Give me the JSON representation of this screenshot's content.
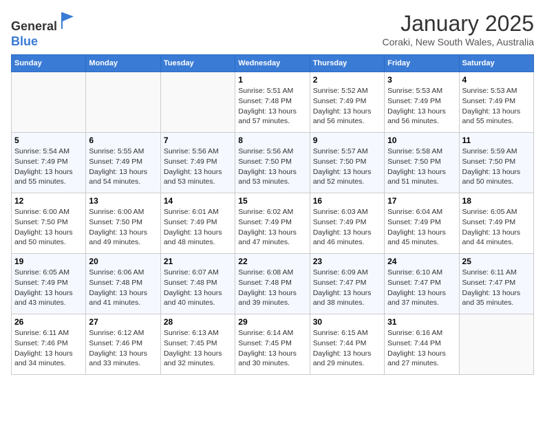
{
  "header": {
    "logo_general": "General",
    "logo_blue": "Blue",
    "month_title": "January 2025",
    "subtitle": "Coraki, New South Wales, Australia"
  },
  "days_of_week": [
    "Sunday",
    "Monday",
    "Tuesday",
    "Wednesday",
    "Thursday",
    "Friday",
    "Saturday"
  ],
  "weeks": [
    [
      {
        "day": "",
        "sunrise": "",
        "sunset": "",
        "daylight": ""
      },
      {
        "day": "",
        "sunrise": "",
        "sunset": "",
        "daylight": ""
      },
      {
        "day": "",
        "sunrise": "",
        "sunset": "",
        "daylight": ""
      },
      {
        "day": "1",
        "sunrise": "Sunrise: 5:51 AM",
        "sunset": "Sunset: 7:48 PM",
        "daylight": "Daylight: 13 hours and 57 minutes."
      },
      {
        "day": "2",
        "sunrise": "Sunrise: 5:52 AM",
        "sunset": "Sunset: 7:49 PM",
        "daylight": "Daylight: 13 hours and 56 minutes."
      },
      {
        "day": "3",
        "sunrise": "Sunrise: 5:53 AM",
        "sunset": "Sunset: 7:49 PM",
        "daylight": "Daylight: 13 hours and 56 minutes."
      },
      {
        "day": "4",
        "sunrise": "Sunrise: 5:53 AM",
        "sunset": "Sunset: 7:49 PM",
        "daylight": "Daylight: 13 hours and 55 minutes."
      }
    ],
    [
      {
        "day": "5",
        "sunrise": "Sunrise: 5:54 AM",
        "sunset": "Sunset: 7:49 PM",
        "daylight": "Daylight: 13 hours and 55 minutes."
      },
      {
        "day": "6",
        "sunrise": "Sunrise: 5:55 AM",
        "sunset": "Sunset: 7:49 PM",
        "daylight": "Daylight: 13 hours and 54 minutes."
      },
      {
        "day": "7",
        "sunrise": "Sunrise: 5:56 AM",
        "sunset": "Sunset: 7:49 PM",
        "daylight": "Daylight: 13 hours and 53 minutes."
      },
      {
        "day": "8",
        "sunrise": "Sunrise: 5:56 AM",
        "sunset": "Sunset: 7:50 PM",
        "daylight": "Daylight: 13 hours and 53 minutes."
      },
      {
        "day": "9",
        "sunrise": "Sunrise: 5:57 AM",
        "sunset": "Sunset: 7:50 PM",
        "daylight": "Daylight: 13 hours and 52 minutes."
      },
      {
        "day": "10",
        "sunrise": "Sunrise: 5:58 AM",
        "sunset": "Sunset: 7:50 PM",
        "daylight": "Daylight: 13 hours and 51 minutes."
      },
      {
        "day": "11",
        "sunrise": "Sunrise: 5:59 AM",
        "sunset": "Sunset: 7:50 PM",
        "daylight": "Daylight: 13 hours and 50 minutes."
      }
    ],
    [
      {
        "day": "12",
        "sunrise": "Sunrise: 6:00 AM",
        "sunset": "Sunset: 7:50 PM",
        "daylight": "Daylight: 13 hours and 50 minutes."
      },
      {
        "day": "13",
        "sunrise": "Sunrise: 6:00 AM",
        "sunset": "Sunset: 7:50 PM",
        "daylight": "Daylight: 13 hours and 49 minutes."
      },
      {
        "day": "14",
        "sunrise": "Sunrise: 6:01 AM",
        "sunset": "Sunset: 7:49 PM",
        "daylight": "Daylight: 13 hours and 48 minutes."
      },
      {
        "day": "15",
        "sunrise": "Sunrise: 6:02 AM",
        "sunset": "Sunset: 7:49 PM",
        "daylight": "Daylight: 13 hours and 47 minutes."
      },
      {
        "day": "16",
        "sunrise": "Sunrise: 6:03 AM",
        "sunset": "Sunset: 7:49 PM",
        "daylight": "Daylight: 13 hours and 46 minutes."
      },
      {
        "day": "17",
        "sunrise": "Sunrise: 6:04 AM",
        "sunset": "Sunset: 7:49 PM",
        "daylight": "Daylight: 13 hours and 45 minutes."
      },
      {
        "day": "18",
        "sunrise": "Sunrise: 6:05 AM",
        "sunset": "Sunset: 7:49 PM",
        "daylight": "Daylight: 13 hours and 44 minutes."
      }
    ],
    [
      {
        "day": "19",
        "sunrise": "Sunrise: 6:05 AM",
        "sunset": "Sunset: 7:49 PM",
        "daylight": "Daylight: 13 hours and 43 minutes."
      },
      {
        "day": "20",
        "sunrise": "Sunrise: 6:06 AM",
        "sunset": "Sunset: 7:48 PM",
        "daylight": "Daylight: 13 hours and 41 minutes."
      },
      {
        "day": "21",
        "sunrise": "Sunrise: 6:07 AM",
        "sunset": "Sunset: 7:48 PM",
        "daylight": "Daylight: 13 hours and 40 minutes."
      },
      {
        "day": "22",
        "sunrise": "Sunrise: 6:08 AM",
        "sunset": "Sunset: 7:48 PM",
        "daylight": "Daylight: 13 hours and 39 minutes."
      },
      {
        "day": "23",
        "sunrise": "Sunrise: 6:09 AM",
        "sunset": "Sunset: 7:47 PM",
        "daylight": "Daylight: 13 hours and 38 minutes."
      },
      {
        "day": "24",
        "sunrise": "Sunrise: 6:10 AM",
        "sunset": "Sunset: 7:47 PM",
        "daylight": "Daylight: 13 hours and 37 minutes."
      },
      {
        "day": "25",
        "sunrise": "Sunrise: 6:11 AM",
        "sunset": "Sunset: 7:47 PM",
        "daylight": "Daylight: 13 hours and 35 minutes."
      }
    ],
    [
      {
        "day": "26",
        "sunrise": "Sunrise: 6:11 AM",
        "sunset": "Sunset: 7:46 PM",
        "daylight": "Daylight: 13 hours and 34 minutes."
      },
      {
        "day": "27",
        "sunrise": "Sunrise: 6:12 AM",
        "sunset": "Sunset: 7:46 PM",
        "daylight": "Daylight: 13 hours and 33 minutes."
      },
      {
        "day": "28",
        "sunrise": "Sunrise: 6:13 AM",
        "sunset": "Sunset: 7:45 PM",
        "daylight": "Daylight: 13 hours and 32 minutes."
      },
      {
        "day": "29",
        "sunrise": "Sunrise: 6:14 AM",
        "sunset": "Sunset: 7:45 PM",
        "daylight": "Daylight: 13 hours and 30 minutes."
      },
      {
        "day": "30",
        "sunrise": "Sunrise: 6:15 AM",
        "sunset": "Sunset: 7:44 PM",
        "daylight": "Daylight: 13 hours and 29 minutes."
      },
      {
        "day": "31",
        "sunrise": "Sunrise: 6:16 AM",
        "sunset": "Sunset: 7:44 PM",
        "daylight": "Daylight: 13 hours and 27 minutes."
      },
      {
        "day": "",
        "sunrise": "",
        "sunset": "",
        "daylight": ""
      }
    ]
  ]
}
